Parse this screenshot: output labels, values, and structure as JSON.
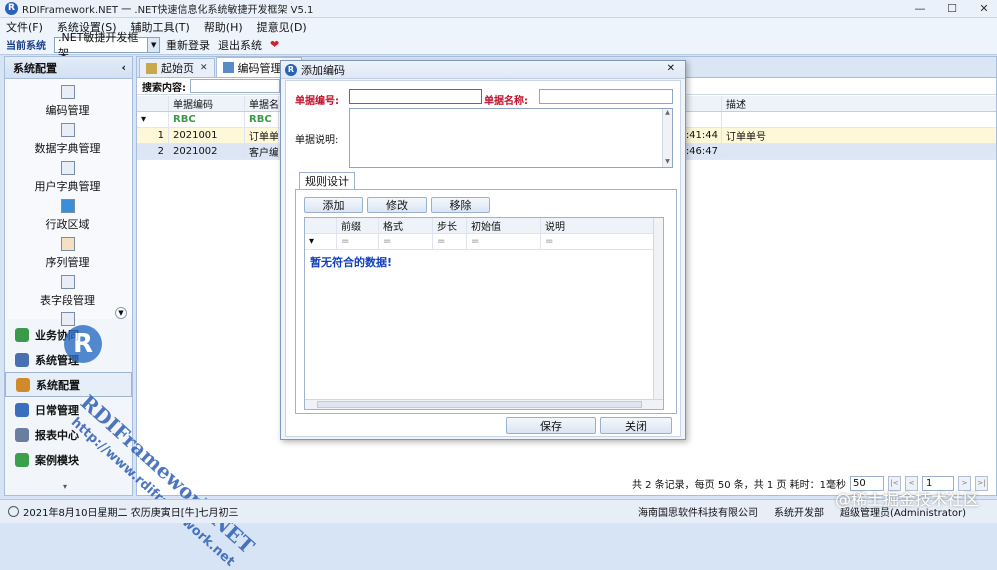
{
  "window": {
    "title": "RDIFramework.NET 一 .NET快速信息化系统敏捷开发框架 V5.1",
    "app_icon": "R",
    "controls": [
      "—",
      "☐",
      "✕"
    ]
  },
  "menu": [
    "文件(F)",
    "系统设置(S)",
    "辅助工具(T)",
    "帮助(H)",
    "提意见(D)"
  ],
  "sysbar": {
    "label": "当前系统",
    "current": ".NET敏捷开发框架",
    "relogin": "重新登录",
    "exit": "退出系统",
    "heart": "❤"
  },
  "left_panel": {
    "header": "系统配置",
    "collapse": "‹",
    "icon_items": [
      "编码管理",
      "数据字典管理",
      "用户字典管理",
      "行政区域",
      "序列管理",
      "表字段管理"
    ],
    "nav": [
      {
        "label": "业务协同",
        "color": "#3a9a4a"
      },
      {
        "label": "系统管理",
        "color": "#4a6fb0"
      },
      {
        "label": "系统配置",
        "color": "#d08a2a"
      },
      {
        "label": "日常管理",
        "color": "#3a6fc0"
      },
      {
        "label": "报表中心",
        "color": "#6a7fa0"
      },
      {
        "label": "案例模块",
        "color": "#3aa04a"
      }
    ]
  },
  "tabs": [
    {
      "label": "起始页",
      "close": "✕"
    },
    {
      "label": "编码管理",
      "close": "✕"
    }
  ],
  "search": {
    "label": "搜索内容:"
  },
  "grid": {
    "columns": [
      "",
      "单据编码",
      "单据名称",
      "",
      "描述"
    ],
    "filter_icon": "▾",
    "rows": [
      {
        "num": "1",
        "code": "2021001",
        "name": "订单单号",
        "time": ":41:44",
        "desc": "订单单号"
      },
      {
        "num": "2",
        "code": "2021002",
        "name": "客户编码",
        "time": ":46:47",
        "desc": ""
      }
    ]
  },
  "pager": {
    "summary": "共 2 条记录，每页 50 条，共 1 页 耗时：1毫秒",
    "page_size": "50",
    "page": "1",
    "first": "|<",
    "prev": "<",
    "next": ">",
    "last": ">|"
  },
  "status": {
    "date": "2021年8月10日星期二 农历庚寅日[牛]七月初三",
    "company": "海南国思软件科技有限公司",
    "dept": "系统开发部",
    "user": "超级管理员(Administrator)"
  },
  "watermark": {
    "big": "RDIFramework.NET",
    "small": "http://www.rdiframework.net",
    "logo": "R",
    "site": "@稀土掘金技术社区"
  },
  "dialog": {
    "title": "添加编码",
    "close": "✕",
    "code_label": "单据编号:",
    "name_label": "单据名称:",
    "desc_label": "单据说明:",
    "code_value": "",
    "name_value": "",
    "rule_tab": "规则设计",
    "buttons": {
      "add": "添加",
      "edit": "修改",
      "remove": "移除",
      "save": "保存",
      "close": "关闭"
    },
    "rule_columns": [
      "前缀",
      "格式",
      "步长",
      "初始值",
      "说明"
    ],
    "filter_placeholder": "=",
    "empty_text": "暂无符合的数据!"
  }
}
